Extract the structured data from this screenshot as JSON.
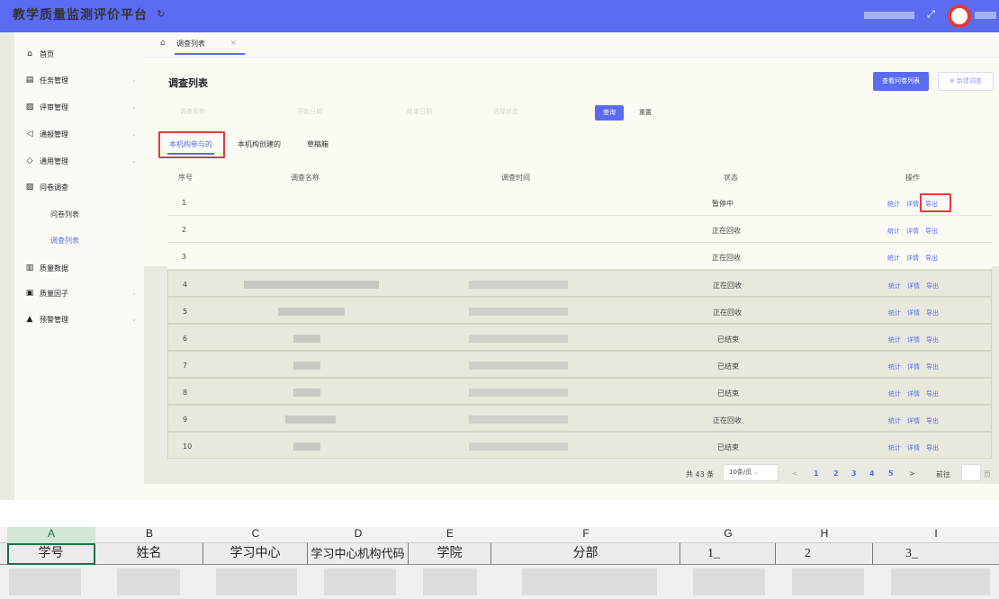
{
  "header": {
    "brand": "教学质量监测评价平台",
    "refresh_icon": "refresh-icon",
    "expand_icon": "expand-icon"
  },
  "sidebar": {
    "items": [
      {
        "label": "首页",
        "icon": "home-icon"
      },
      {
        "label": "任务管理",
        "icon": "task-icon"
      },
      {
        "label": "评审管理",
        "icon": "review-icon"
      },
      {
        "label": "通报管理",
        "icon": "notice-icon"
      },
      {
        "label": "通用管理",
        "icon": "tag-icon"
      },
      {
        "label": "问卷调查",
        "icon": "survey-icon"
      },
      {
        "label": "质量数据",
        "icon": "data-icon"
      },
      {
        "label": "质量因子",
        "icon": "factor-icon"
      },
      {
        "label": "预警管理",
        "icon": "warning-icon"
      }
    ],
    "subitems": [
      "问卷列表",
      "调查列表"
    ]
  },
  "tabs": {
    "open_tab": "调查列表",
    "close": "×"
  },
  "page": {
    "title": "调查列表",
    "btn_view_questionnaires": "查看问卷列表",
    "btn_new_survey": "新建调查",
    "filters": [
      "调查名称",
      "开始日期",
      "结束日期",
      "选择状态"
    ],
    "btn_query": "查询",
    "btn_reset": "重置",
    "sub_tabs": [
      "本机构参与的",
      "本机构创建的",
      "草稿箱"
    ]
  },
  "table": {
    "headers": [
      "序号",
      "调查名称",
      "调查时间",
      "状态",
      "操作"
    ],
    "rows": [
      {
        "no": "1",
        "status": "暂停中"
      },
      {
        "no": "2",
        "status": "正在回收"
      },
      {
        "no": "3",
        "status": "正在回收"
      },
      {
        "no": "4",
        "status": "正在回收"
      },
      {
        "no": "5",
        "status": "正在回收"
      },
      {
        "no": "6",
        "status": "已结束"
      },
      {
        "no": "7",
        "status": "已结束"
      },
      {
        "no": "8",
        "status": "已结束"
      },
      {
        "no": "9",
        "status": "正在回收"
      },
      {
        "no": "10",
        "status": "已结束"
      }
    ],
    "actions": [
      "统计",
      "详情",
      "导出"
    ]
  },
  "pagination": {
    "total": "共 43 条",
    "page_size": "10条/页",
    "prev": "<",
    "pages": [
      "1",
      "2",
      "3",
      "4",
      "5"
    ],
    "next": ">",
    "goto": "前往",
    "page_unit": "页"
  },
  "spreadsheet": {
    "columns": [
      "A",
      "B",
      "C",
      "D",
      "E",
      "F",
      "G",
      "H",
      "I"
    ],
    "headers": [
      "学号",
      "姓名",
      "学习中心",
      "学习中心机构代码",
      "学院",
      "分部",
      "1_",
      "2",
      "3_"
    ]
  },
  "colors": {
    "accent": "#5b6cf0",
    "highlight_box": "#e53935",
    "excel_green": "#1e7145"
  }
}
